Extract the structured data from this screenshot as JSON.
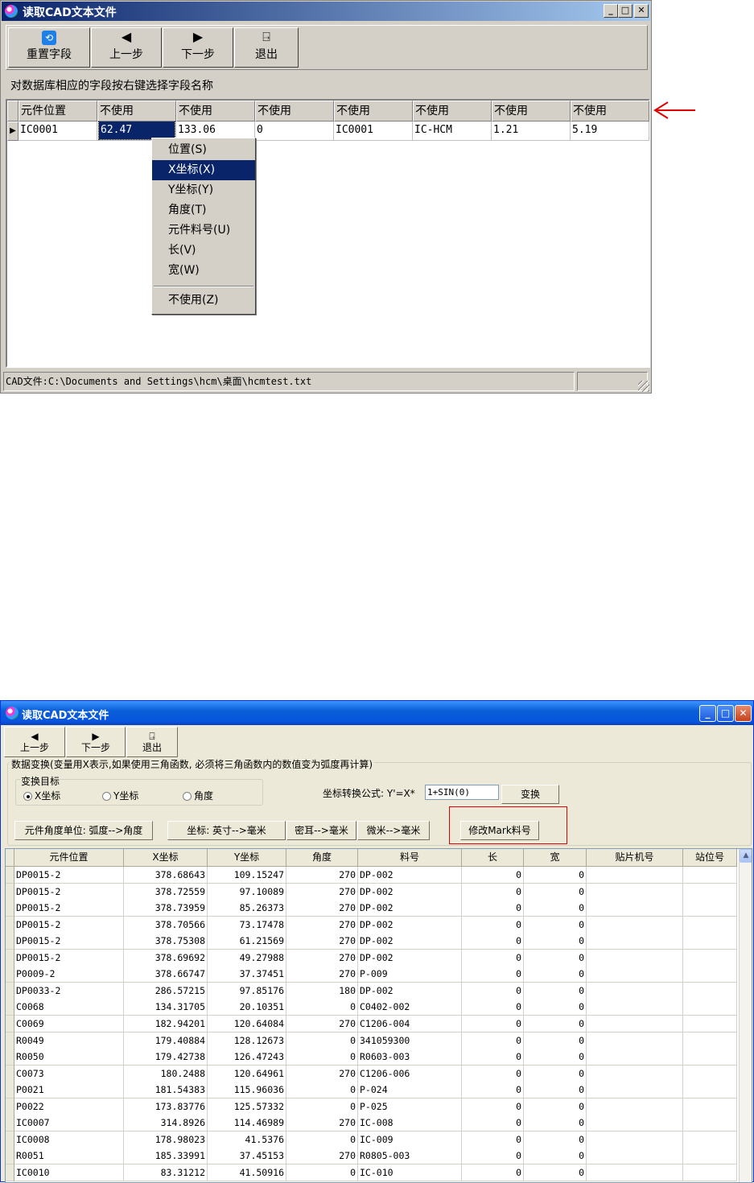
{
  "window1": {
    "title": "读取CAD文本文件",
    "toolbar": [
      {
        "icon": "reset-icon",
        "glyph": "⟲",
        "label": "重置字段"
      },
      {
        "icon": "arrow-left-icon",
        "glyph": "◀",
        "label": "上一步"
      },
      {
        "icon": "arrow-right-icon",
        "glyph": "▶",
        "label": "下一步"
      },
      {
        "icon": "exit-door-icon",
        "glyph": "⍈",
        "label": "退出"
      }
    ],
    "instruction": "对数据库相应的字段按右键选择字段名称",
    "columns": [
      "元件位置",
      "不使用",
      "不使用",
      "不使用",
      "不使用",
      "不使用",
      "不使用",
      "不使用"
    ],
    "row": [
      "IC0001",
      "62.47",
      "133.06",
      "0",
      "IC0001",
      "IC-HCM",
      "1.21",
      "5.19"
    ],
    "context_menu": [
      "位置(S)",
      "X坐标(X)",
      "Y坐标(Y)",
      "角度(T)",
      "元件料号(U)",
      "长(V)",
      "宽(W)",
      "不使用(Z)"
    ],
    "selected_menu_index": 1,
    "status": "CAD文件:C:\\Documents and Settings\\hcm\\桌面\\hcmtest.txt",
    "arrow_color": "#e00000"
  },
  "window2": {
    "title": "读取CAD文本文件",
    "toolbar": [
      {
        "icon": "arrow-left-icon",
        "glyph": "◀",
        "label": "上一步"
      },
      {
        "icon": "arrow-right-icon",
        "glyph": "▶",
        "label": "下一步"
      },
      {
        "icon": "exit-door-icon",
        "glyph": "⍈",
        "label": "退出"
      }
    ],
    "group_caption": "数据变换(变量用X表示,如果使用三角函数, 必须将三角函数内的数值变为弧度再计算)",
    "target_group_label": "变换目标",
    "radios": [
      {
        "label": "X坐标",
        "checked": true
      },
      {
        "label": "Y坐标",
        "checked": false
      },
      {
        "label": "角度",
        "checked": false
      }
    ],
    "formula_label": "坐标转换公式: Y'=X*",
    "formula_value": "1+SIN(0)",
    "transform_button": "变换",
    "buttons": [
      "元件角度单位: 弧度-->角度",
      "坐标: 英寸-->毫米",
      "密耳-->毫米",
      "微米-->毫米",
      "修改Mark料号"
    ],
    "highlight_color": "#e00000",
    "columns": [
      "元件位置",
      "X坐标",
      "Y坐标",
      "角度",
      "料号",
      "长",
      "宽",
      "贴片机号",
      "站位号"
    ],
    "rows": [
      [
        "DP0015-2",
        "378.68643",
        "109.15247",
        "270",
        "DP-002",
        "0",
        "0",
        "",
        ""
      ],
      [
        "DP0015-2",
        "378.72559",
        "97.10089",
        "270",
        "DP-002",
        "0",
        "0",
        "",
        ""
      ],
      [
        "DP0015-2",
        "378.73959",
        "85.26373",
        "270",
        "DP-002",
        "0",
        "0",
        "",
        ""
      ],
      [
        "DP0015-2",
        "378.70566",
        "73.17478",
        "270",
        "DP-002",
        "0",
        "0",
        "",
        ""
      ],
      [
        "DP0015-2",
        "378.75308",
        "61.21569",
        "270",
        "DP-002",
        "0",
        "0",
        "",
        ""
      ],
      [
        "DP0015-2",
        "378.69692",
        "49.27988",
        "270",
        "DP-002",
        "0",
        "0",
        "",
        ""
      ],
      [
        "P0009-2",
        "378.66747",
        "37.37451",
        "270",
        "P-009",
        "0",
        "0",
        "",
        ""
      ],
      [
        "DP0033-2",
        "286.57215",
        "97.85176",
        "180",
        "DP-002",
        "0",
        "0",
        "",
        ""
      ],
      [
        "C0068",
        "134.31705",
        "20.10351",
        "0",
        "C0402-002",
        "0",
        "0",
        "",
        ""
      ],
      [
        "C0069",
        "182.94201",
        "120.64084",
        "270",
        "C1206-004",
        "0",
        "0",
        "",
        ""
      ],
      [
        "R0049",
        "179.40884",
        "128.12673",
        "0",
        "341059300",
        "0",
        "0",
        "",
        ""
      ],
      [
        "R0050",
        "179.42738",
        "126.47243",
        "0",
        "R0603-003",
        "0",
        "0",
        "",
        ""
      ],
      [
        "C0073",
        "180.2488",
        "120.64961",
        "270",
        "C1206-006",
        "0",
        "0",
        "",
        ""
      ],
      [
        "P0021",
        "181.54383",
        "115.96036",
        "0",
        "P-024",
        "0",
        "0",
        "",
        ""
      ],
      [
        "P0022",
        "173.83776",
        "125.57332",
        "0",
        "P-025",
        "0",
        "0",
        "",
        ""
      ],
      [
        "IC0007",
        "314.8926",
        "114.46989",
        "270",
        "IC-008",
        "0",
        "0",
        "",
        ""
      ],
      [
        "IC0008",
        "178.98023",
        "41.5376",
        "0",
        "IC-009",
        "0",
        "0",
        "",
        ""
      ],
      [
        "R0051",
        "185.33991",
        "37.45153",
        "270",
        "R0805-003",
        "0",
        "0",
        "",
        ""
      ],
      [
        "IC0010",
        "83.31212",
        "41.50916",
        "0",
        "IC-010",
        "0",
        "0",
        "",
        ""
      ]
    ]
  }
}
